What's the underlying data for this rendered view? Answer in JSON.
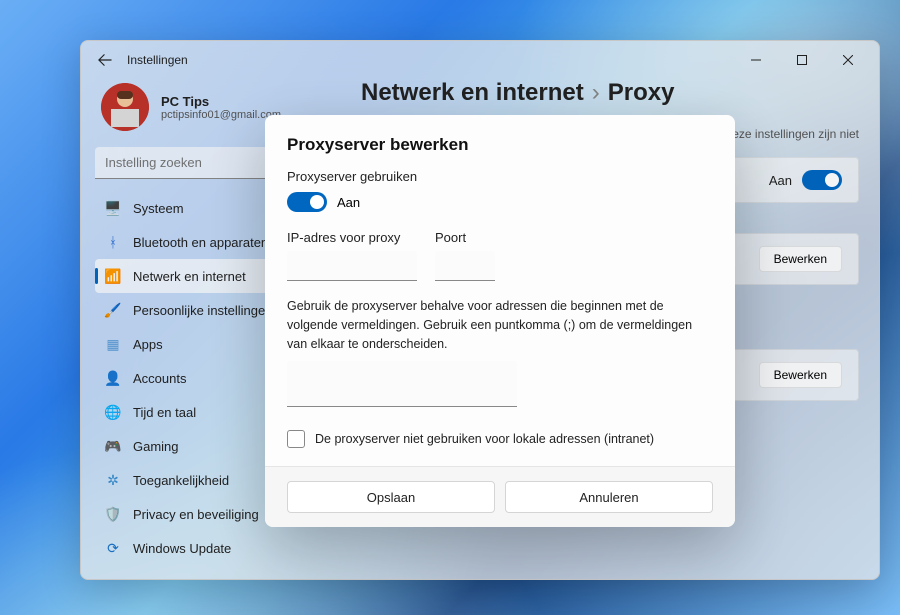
{
  "app_title": "Instellingen",
  "user": {
    "name": "PC Tips",
    "email": "pctipsinfo01@gmail.com"
  },
  "search": {
    "placeholder": "Instelling zoeken"
  },
  "sidebar": {
    "items": [
      {
        "label": "Systeem",
        "icon": "🖥️",
        "color": "#4a88c8"
      },
      {
        "label": "Bluetooth en apparaten",
        "icon": "ᚼ",
        "color": "#2a6fd6"
      },
      {
        "label": "Netwerk en internet",
        "icon": "📶",
        "color": "#4a88c8",
        "active": true
      },
      {
        "label": "Persoonlijke instellingen",
        "icon": "🖌️",
        "color": "#3a6ba5"
      },
      {
        "label": "Apps",
        "icon": "▦",
        "color": "#5a9bd5"
      },
      {
        "label": "Accounts",
        "icon": "👤",
        "color": "#3cb371"
      },
      {
        "label": "Tijd en taal",
        "icon": "🌐",
        "color": "#c58a3e"
      },
      {
        "label": "Gaming",
        "icon": "🎮",
        "color": "#777"
      },
      {
        "label": "Toegankelijkheid",
        "icon": "✲",
        "color": "#3a8dd0"
      },
      {
        "label": "Privacy en beveiliging",
        "icon": "🛡️",
        "color": "#777"
      },
      {
        "label": "Windows Update",
        "icon": "⟳",
        "color": "#1a73c8"
      }
    ]
  },
  "main": {
    "breadcrumb_parent": "Netwerk en internet",
    "breadcrumb_sep": "›",
    "breadcrumb_current": "Proxy",
    "note_tail": "en. Deze instellingen zijn niet",
    "cards": [
      {
        "right_label": "Aan",
        "has_toggle": true
      },
      {
        "button": "Bewerken"
      },
      {
        "button": "Bewerken"
      }
    ]
  },
  "dialog": {
    "title": "Proxyserver bewerken",
    "use_proxy_label": "Proxyserver gebruiken",
    "toggle_state": "Aan",
    "ip_label": "IP-adres voor proxy",
    "port_label": "Poort",
    "ip_value": "",
    "port_value": "",
    "hint": "Gebruik de proxyserver behalve voor adressen die beginnen met de volgende vermeldingen. Gebruik een puntkomma (;) om de vermeldingen van elkaar te onderscheiden.",
    "exceptions_value": "",
    "checkbox_label": "De proxyserver niet gebruiken voor lokale adressen (intranet)",
    "save": "Opslaan",
    "cancel": "Annuleren"
  }
}
